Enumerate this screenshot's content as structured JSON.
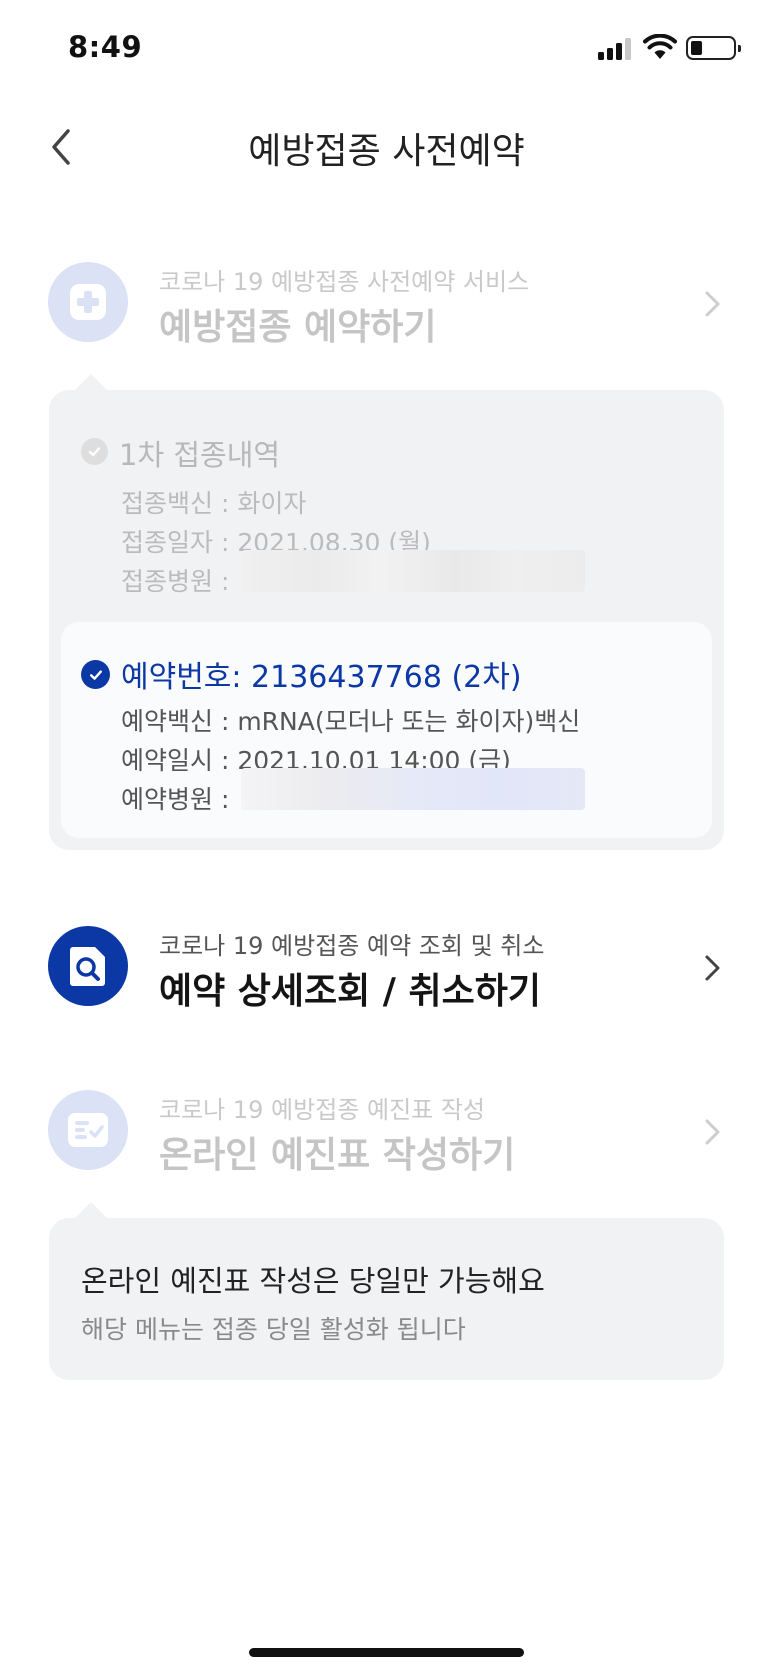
{
  "status_bar": {
    "time": "8:49"
  },
  "header": {
    "title": "예방접종 사전예약"
  },
  "reservation_menu": {
    "subtitle": "코로나 19 예방접종 사전예약 서비스",
    "title": "예방접종 예약하기"
  },
  "history": {
    "title": "1차 접종내역",
    "vaccine": "접종백신 : 화이자",
    "date": "접종일자 : 2021.08.30 (월)",
    "hospital_label": "접종병원 :"
  },
  "booking": {
    "title": "예약번호: 2136437768 (2차)",
    "vaccine": "예약백신 : mRNA(모더나 또는 화이자)백신",
    "datetime": "예약일시 : 2021.10.01 14:00 (금)",
    "hospital_label": "예약병원 :"
  },
  "inquiry_menu": {
    "subtitle": "코로나 19 예방접종 예약 조회 및 취소",
    "title": "예약 상세조회 / 취소하기"
  },
  "questionnaire_menu": {
    "subtitle": "코로나 19 예방접종 예진표 작성",
    "title": "온라인 예진표 작성하기"
  },
  "notice": {
    "title": "온라인 예진표 작성은 당일만 가능해요",
    "subtitle": "해당 메뉴는 접종 당일 활성화 됩니다"
  },
  "colors": {
    "brand_blue": "#0c38a6",
    "faded_icon_bg": "#dbe2f6",
    "panel_bg": "#f1f2f4"
  },
  "icons": {
    "reservation": "plus-square-icon",
    "inquiry": "search-document-icon",
    "questionnaire": "checklist-icon"
  }
}
